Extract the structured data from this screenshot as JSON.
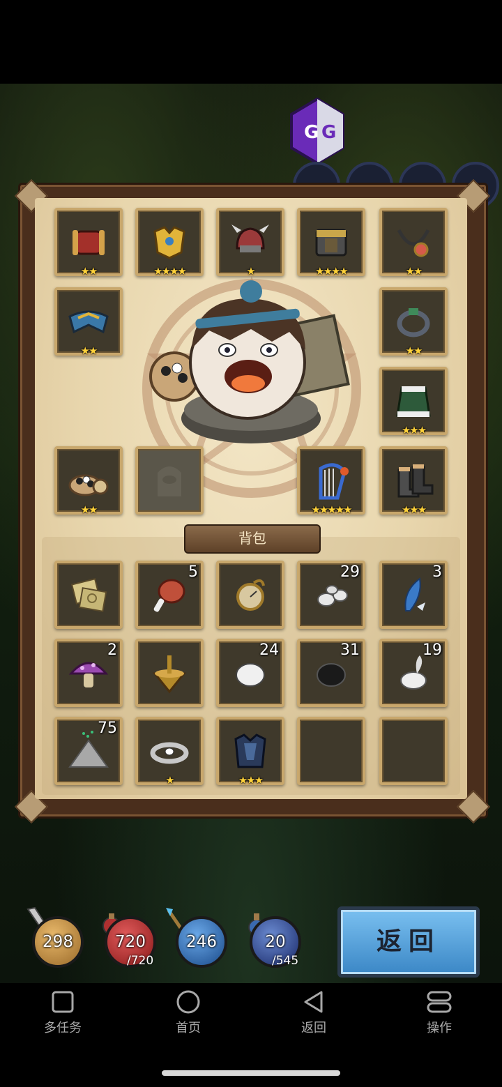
{
  "equipment": {
    "slots": [
      {
        "icon": "bracer-icon",
        "stars": "★★"
      },
      {
        "icon": "gold-armor-icon",
        "stars": "★★★★"
      },
      {
        "icon": "helmet-icon",
        "stars": "★"
      },
      {
        "icon": "chest-armor-icon",
        "stars": "★★★★"
      },
      {
        "icon": "necklace-icon",
        "stars": "★★"
      },
      {
        "icon": "shoulder-armor-icon",
        "stars": "★★"
      },
      {
        "icon": "ring-icon",
        "stars": "★★"
      },
      {
        "icon": "cloak-icon",
        "stars": "★★★"
      },
      {
        "icon": "go-bowl-icon",
        "stars": "★★"
      },
      {
        "icon": "empty-slot-icon",
        "stars": ""
      },
      {
        "icon": "harp-weapon-icon",
        "stars": "★★★★★"
      },
      {
        "icon": "boots-icon",
        "stars": "★★★"
      }
    ]
  },
  "backpack": {
    "label": "背包",
    "slots": [
      {
        "icon": "scroll-map-icon",
        "count": ""
      },
      {
        "icon": "meat-icon",
        "count": "5"
      },
      {
        "icon": "compass-icon",
        "count": ""
      },
      {
        "icon": "silver-stones-icon",
        "count": "29"
      },
      {
        "icon": "feather-icon",
        "count": "3"
      },
      {
        "icon": "mushroom-icon",
        "count": "2"
      },
      {
        "icon": "spinning-top-icon",
        "count": ""
      },
      {
        "icon": "white-stone-icon",
        "count": "24"
      },
      {
        "icon": "black-stone-icon",
        "count": "31"
      },
      {
        "icon": "white-spirit-icon",
        "count": "19"
      },
      {
        "icon": "powder-pile-icon",
        "count": "75"
      },
      {
        "icon": "silver-ring-icon",
        "count": "",
        "stars": "★"
      },
      {
        "icon": "dark-armor-icon",
        "count": "",
        "stars": "★★★"
      },
      {
        "icon": "empty-slot",
        "count": ""
      },
      {
        "icon": "empty-slot",
        "count": ""
      }
    ]
  },
  "hud": {
    "attack": "298",
    "hp": "720",
    "hp_max": "/720",
    "mana": "246",
    "level": "20",
    "level_max": "/545",
    "return_label": "返回"
  },
  "nav": {
    "multitask": "多任务",
    "home": "首页",
    "back": "返回",
    "operate": "操作"
  },
  "overlay": {
    "gg_label": "GG"
  }
}
